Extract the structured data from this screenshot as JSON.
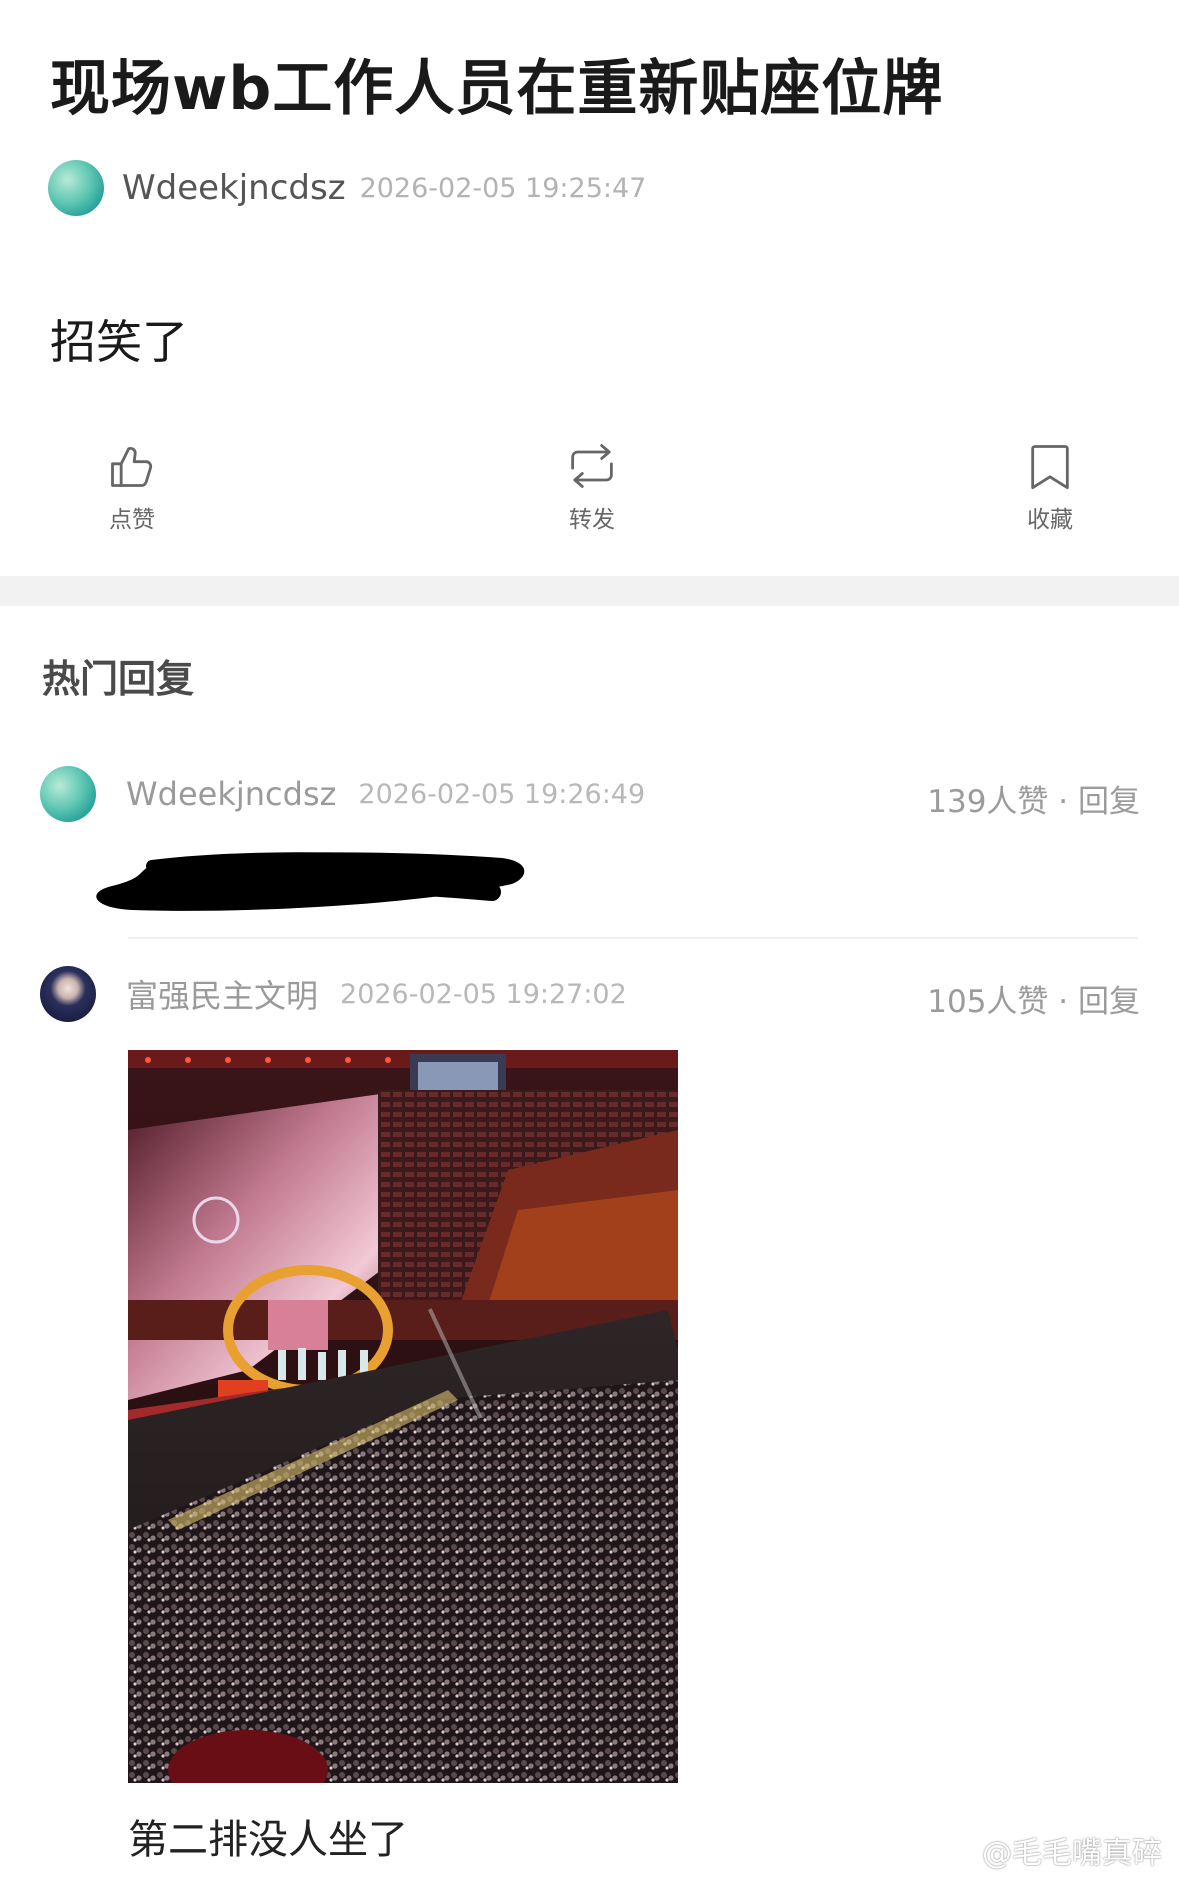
{
  "post": {
    "title": "现场wb工作人员在重新贴座位牌",
    "author": "Wdeekjncdsz",
    "time": "2026-02-05 19:25:47",
    "body": "招笑了"
  },
  "actions": {
    "like": "点赞",
    "repost": "转发",
    "favorite": "收藏"
  },
  "replies_section": {
    "title": "热门回复"
  },
  "replies": [
    {
      "author": "Wdeekjncdsz",
      "time": "2026-02-05 19:26:49",
      "likes": "139人赞",
      "reply_label": "回复"
    },
    {
      "author": "富强民主文明",
      "time": "2026-02-05 19:27:02",
      "likes": "105人赞",
      "reply_label": "回复",
      "caption": "第二排没人坐了"
    }
  ],
  "separator": " · ",
  "watermark": "@毛毛嘴真碎",
  "icons": [
    "thumbs-up-icon",
    "repost-icon",
    "bookmark-icon",
    "weibo-logo-icon"
  ]
}
